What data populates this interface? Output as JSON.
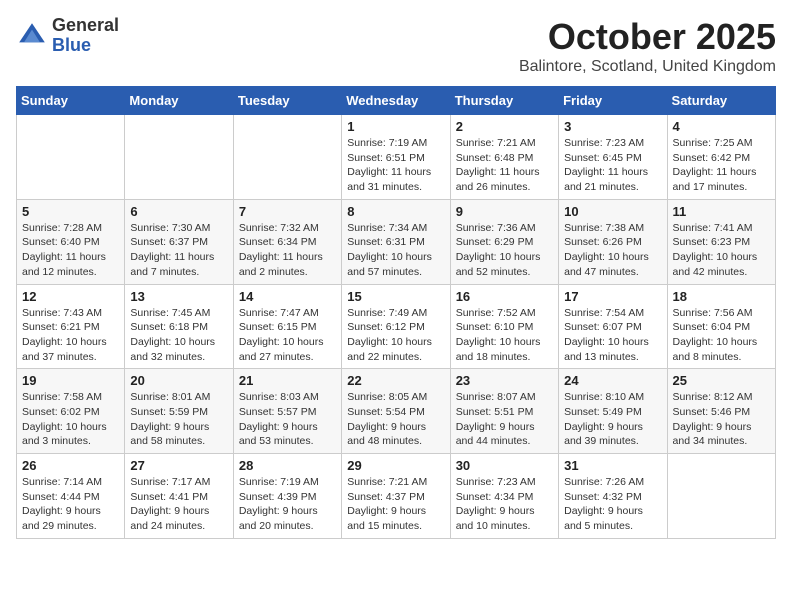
{
  "logo": {
    "general": "General",
    "blue": "Blue"
  },
  "title": "October 2025",
  "location": "Balintore, Scotland, United Kingdom",
  "weekdays": [
    "Sunday",
    "Monday",
    "Tuesday",
    "Wednesday",
    "Thursday",
    "Friday",
    "Saturday"
  ],
  "weeks": [
    [
      {
        "num": "",
        "info": ""
      },
      {
        "num": "",
        "info": ""
      },
      {
        "num": "",
        "info": ""
      },
      {
        "num": "1",
        "info": "Sunrise: 7:19 AM\nSunset: 6:51 PM\nDaylight: 11 hours\nand 31 minutes."
      },
      {
        "num": "2",
        "info": "Sunrise: 7:21 AM\nSunset: 6:48 PM\nDaylight: 11 hours\nand 26 minutes."
      },
      {
        "num": "3",
        "info": "Sunrise: 7:23 AM\nSunset: 6:45 PM\nDaylight: 11 hours\nand 21 minutes."
      },
      {
        "num": "4",
        "info": "Sunrise: 7:25 AM\nSunset: 6:42 PM\nDaylight: 11 hours\nand 17 minutes."
      }
    ],
    [
      {
        "num": "5",
        "info": "Sunrise: 7:28 AM\nSunset: 6:40 PM\nDaylight: 11 hours\nand 12 minutes."
      },
      {
        "num": "6",
        "info": "Sunrise: 7:30 AM\nSunset: 6:37 PM\nDaylight: 11 hours\nand 7 minutes."
      },
      {
        "num": "7",
        "info": "Sunrise: 7:32 AM\nSunset: 6:34 PM\nDaylight: 11 hours\nand 2 minutes."
      },
      {
        "num": "8",
        "info": "Sunrise: 7:34 AM\nSunset: 6:31 PM\nDaylight: 10 hours\nand 57 minutes."
      },
      {
        "num": "9",
        "info": "Sunrise: 7:36 AM\nSunset: 6:29 PM\nDaylight: 10 hours\nand 52 minutes."
      },
      {
        "num": "10",
        "info": "Sunrise: 7:38 AM\nSunset: 6:26 PM\nDaylight: 10 hours\nand 47 minutes."
      },
      {
        "num": "11",
        "info": "Sunrise: 7:41 AM\nSunset: 6:23 PM\nDaylight: 10 hours\nand 42 minutes."
      }
    ],
    [
      {
        "num": "12",
        "info": "Sunrise: 7:43 AM\nSunset: 6:21 PM\nDaylight: 10 hours\nand 37 minutes."
      },
      {
        "num": "13",
        "info": "Sunrise: 7:45 AM\nSunset: 6:18 PM\nDaylight: 10 hours\nand 32 minutes."
      },
      {
        "num": "14",
        "info": "Sunrise: 7:47 AM\nSunset: 6:15 PM\nDaylight: 10 hours\nand 27 minutes."
      },
      {
        "num": "15",
        "info": "Sunrise: 7:49 AM\nSunset: 6:12 PM\nDaylight: 10 hours\nand 22 minutes."
      },
      {
        "num": "16",
        "info": "Sunrise: 7:52 AM\nSunset: 6:10 PM\nDaylight: 10 hours\nand 18 minutes."
      },
      {
        "num": "17",
        "info": "Sunrise: 7:54 AM\nSunset: 6:07 PM\nDaylight: 10 hours\nand 13 minutes."
      },
      {
        "num": "18",
        "info": "Sunrise: 7:56 AM\nSunset: 6:04 PM\nDaylight: 10 hours\nand 8 minutes."
      }
    ],
    [
      {
        "num": "19",
        "info": "Sunrise: 7:58 AM\nSunset: 6:02 PM\nDaylight: 10 hours\nand 3 minutes."
      },
      {
        "num": "20",
        "info": "Sunrise: 8:01 AM\nSunset: 5:59 PM\nDaylight: 9 hours\nand 58 minutes."
      },
      {
        "num": "21",
        "info": "Sunrise: 8:03 AM\nSunset: 5:57 PM\nDaylight: 9 hours\nand 53 minutes."
      },
      {
        "num": "22",
        "info": "Sunrise: 8:05 AM\nSunset: 5:54 PM\nDaylight: 9 hours\nand 48 minutes."
      },
      {
        "num": "23",
        "info": "Sunrise: 8:07 AM\nSunset: 5:51 PM\nDaylight: 9 hours\nand 44 minutes."
      },
      {
        "num": "24",
        "info": "Sunrise: 8:10 AM\nSunset: 5:49 PM\nDaylight: 9 hours\nand 39 minutes."
      },
      {
        "num": "25",
        "info": "Sunrise: 8:12 AM\nSunset: 5:46 PM\nDaylight: 9 hours\nand 34 minutes."
      }
    ],
    [
      {
        "num": "26",
        "info": "Sunrise: 7:14 AM\nSunset: 4:44 PM\nDaylight: 9 hours\nand 29 minutes."
      },
      {
        "num": "27",
        "info": "Sunrise: 7:17 AM\nSunset: 4:41 PM\nDaylight: 9 hours\nand 24 minutes."
      },
      {
        "num": "28",
        "info": "Sunrise: 7:19 AM\nSunset: 4:39 PM\nDaylight: 9 hours\nand 20 minutes."
      },
      {
        "num": "29",
        "info": "Sunrise: 7:21 AM\nSunset: 4:37 PM\nDaylight: 9 hours\nand 15 minutes."
      },
      {
        "num": "30",
        "info": "Sunrise: 7:23 AM\nSunset: 4:34 PM\nDaylight: 9 hours\nand 10 minutes."
      },
      {
        "num": "31",
        "info": "Sunrise: 7:26 AM\nSunset: 4:32 PM\nDaylight: 9 hours\nand 5 minutes."
      },
      {
        "num": "",
        "info": ""
      }
    ]
  ]
}
